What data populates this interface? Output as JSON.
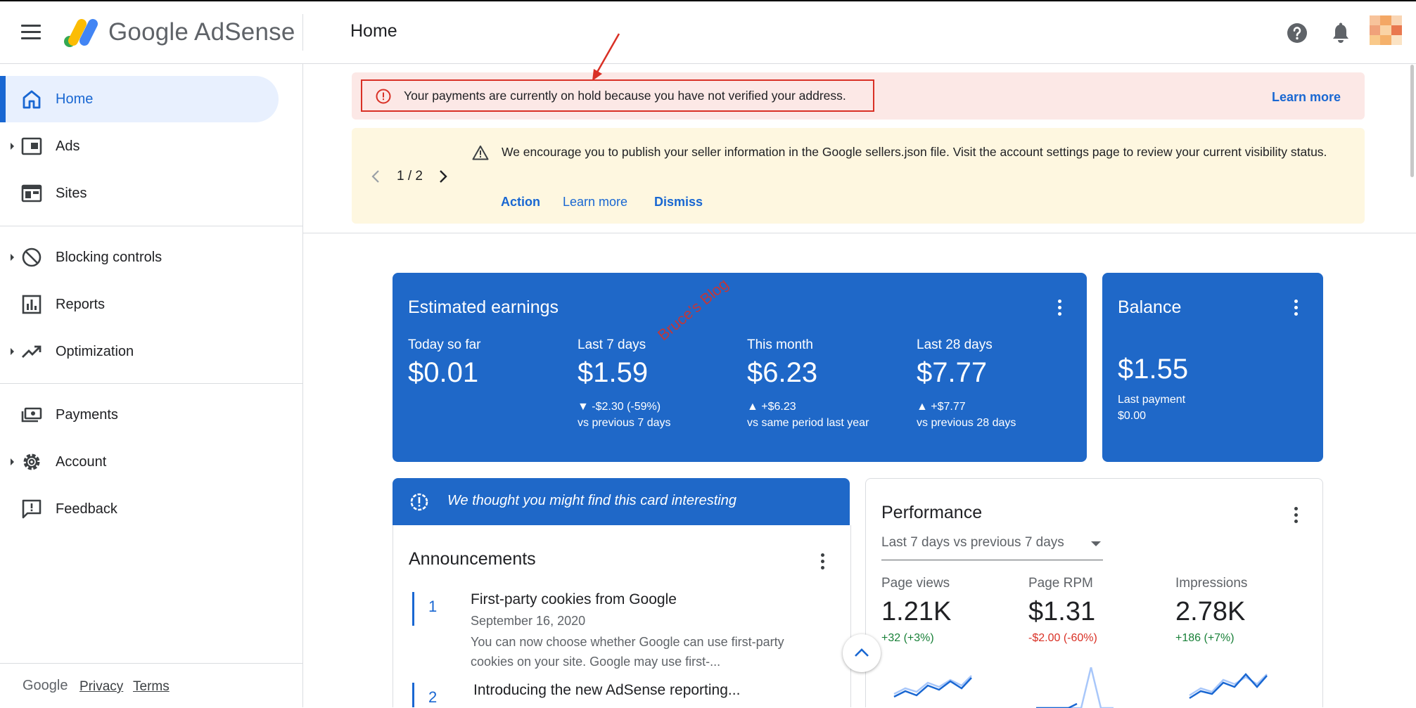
{
  "header": {
    "logo_text": "Google AdSense",
    "page_title": "Home"
  },
  "sidebar": {
    "items": [
      {
        "label": "Home"
      },
      {
        "label": "Ads"
      },
      {
        "label": "Sites"
      },
      {
        "label": "Blocking controls"
      },
      {
        "label": "Reports"
      },
      {
        "label": "Optimization"
      },
      {
        "label": "Payments"
      },
      {
        "label": "Account"
      },
      {
        "label": "Feedback"
      }
    ],
    "footer": {
      "brand": "Google",
      "privacy": "Privacy",
      "terms": "Terms"
    }
  },
  "alerts": {
    "hold": {
      "text": "Your payments are currently on hold because you have not verified your address.",
      "link": "Learn more"
    },
    "sellers": {
      "pager": "1 / 2",
      "text": "We encourage you to publish your seller information in the Google sellers.json file. Visit the account settings page to review your current visibility status.",
      "actions": {
        "action": "Action",
        "learn_more": "Learn more",
        "dismiss": "Dismiss"
      }
    }
  },
  "earnings": {
    "title": "Estimated earnings",
    "metrics": [
      {
        "label": "Today so far",
        "value": "$0.01",
        "change": "",
        "compare": ""
      },
      {
        "label": "Last 7 days",
        "value": "$1.59",
        "change": "▼ -$2.30 (-59%)",
        "compare": "vs previous 7 days"
      },
      {
        "label": "This month",
        "value": "$6.23",
        "change": "▲ +$6.23",
        "compare": "vs same period last year"
      },
      {
        "label": "Last 28 days",
        "value": "$7.77",
        "change": "▲ +$7.77",
        "compare": "vs previous 28 days"
      }
    ],
    "watermark": "Bruce's Blog"
  },
  "balance": {
    "title": "Balance",
    "value": "$1.55",
    "last_payment_label": "Last payment",
    "last_payment_value": "$0.00"
  },
  "interesting": {
    "text": "We thought you might find this card interesting"
  },
  "announcements": {
    "title": "Announcements",
    "items": [
      {
        "num": "1",
        "title": "First-party cookies from Google",
        "date": "September 16, 2020",
        "body": "You can now choose whether Google can use first-party cookies on your site. Google may use first-..."
      },
      {
        "num": "2",
        "title": "Introducing the new AdSense reporting..."
      }
    ]
  },
  "performance": {
    "title": "Performance",
    "range": "Last 7 days vs previous 7 days",
    "metrics": [
      {
        "label": "Page views",
        "value": "1.21K",
        "change": "+32 (+3%)"
      },
      {
        "label": "Page RPM",
        "value": "$1.31",
        "change": "-$2.00 (-60%)"
      },
      {
        "label": "Impressions",
        "value": "2.78K",
        "change": "+186 (+7%)"
      }
    ]
  },
  "colors": {
    "brand_blue": "#1f68c8",
    "link_blue": "#1967d2",
    "alert_red_bg": "#fce8e6",
    "alert_yellow_bg": "#fef7e0",
    "positive": "#188038",
    "negative": "#d93025"
  }
}
